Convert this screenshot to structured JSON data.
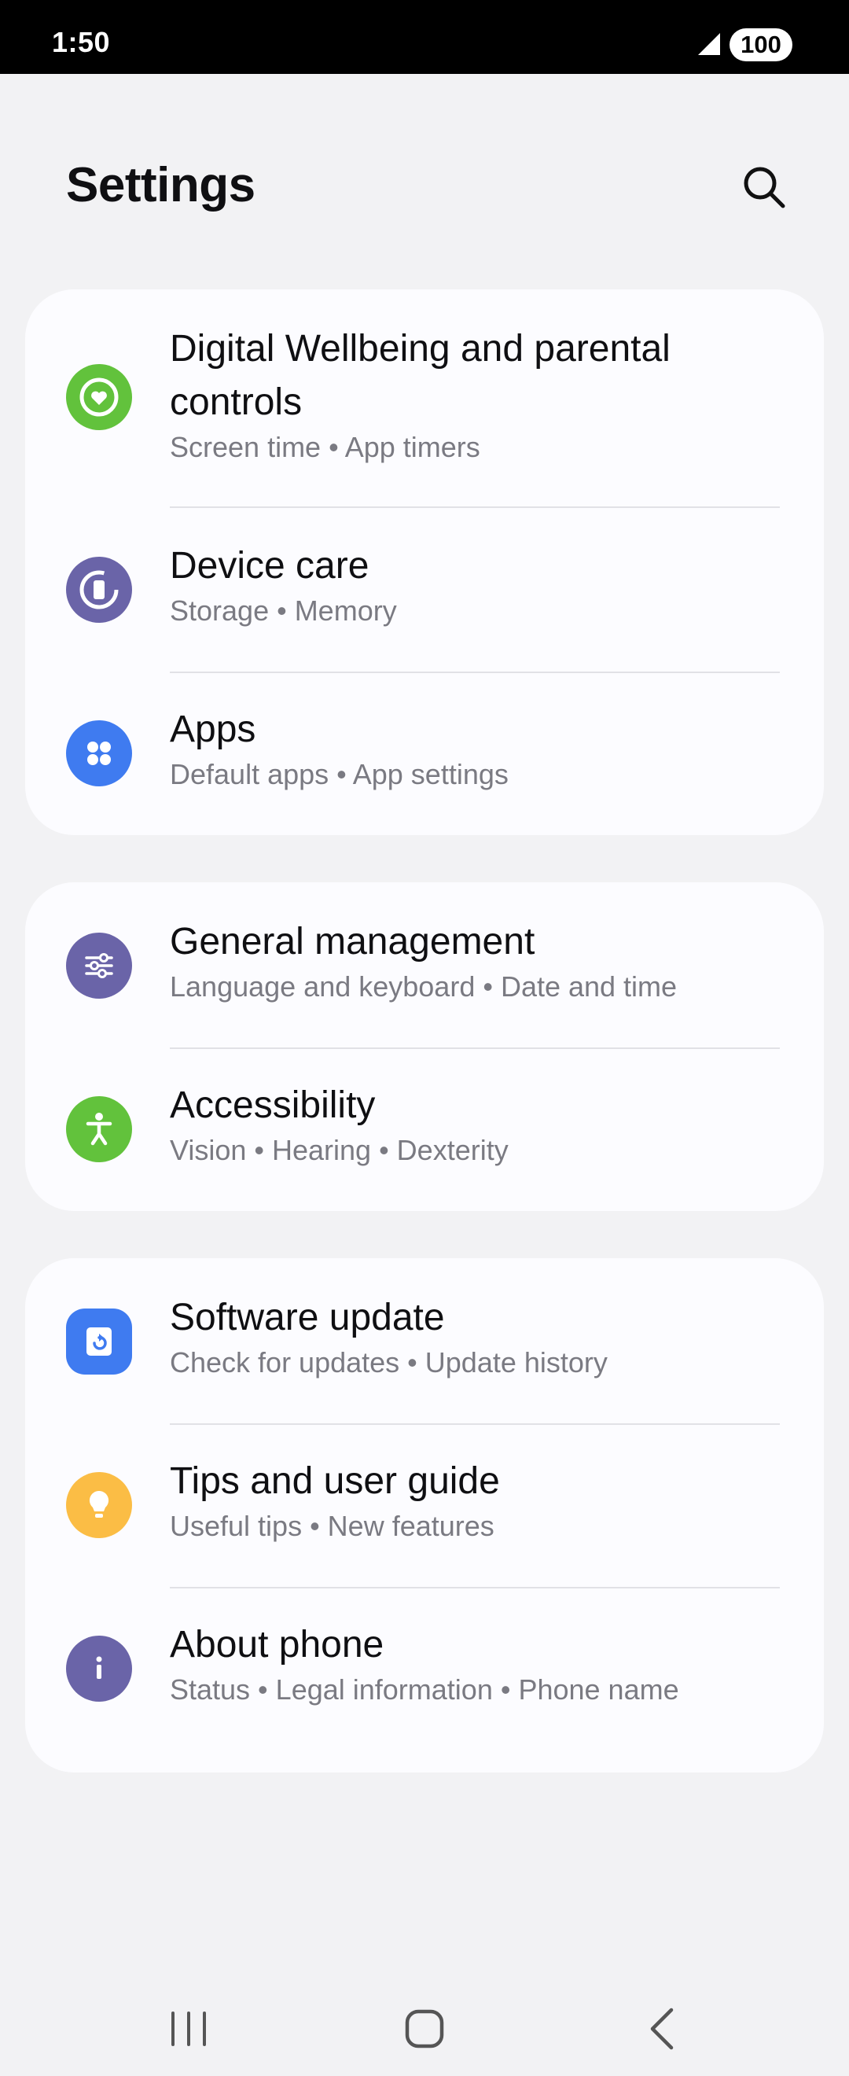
{
  "status_bar": {
    "time": "1:50",
    "battery": "100",
    "signal_icon": "cell-signal-icon"
  },
  "header": {
    "title": "Settings",
    "search_icon": "search-icon"
  },
  "cards": [
    {
      "items": [
        {
          "title": "Digital Wellbeing and parental controls",
          "subtitle": "Screen time  •  App timers",
          "icon": "digital-wellbeing-icon",
          "icon_color": "#62c23c"
        },
        {
          "title": "Device care",
          "subtitle": "Storage  •  Memory",
          "icon": "device-care-icon",
          "icon_color": "#6a64a8"
        },
        {
          "title": "Apps",
          "subtitle": "Default apps  •  App settings",
          "icon": "apps-icon",
          "icon_color": "#3f7bf0"
        }
      ]
    },
    {
      "items": [
        {
          "title": "General management",
          "subtitle": "Language and keyboard  •  Date and time",
          "icon": "general-management-icon",
          "icon_color": "#6a64a8"
        },
        {
          "title": "Accessibility",
          "subtitle": "Vision  •  Hearing  •  Dexterity",
          "icon": "accessibility-icon",
          "icon_color": "#62c23c"
        }
      ]
    },
    {
      "items": [
        {
          "title": "Software update",
          "subtitle": "Check for updates  •  Update history",
          "icon": "software-update-icon",
          "icon_color": "#3f7bf0"
        },
        {
          "title": "Tips and user guide",
          "subtitle": "Useful tips  •  New features",
          "icon": "tips-lightbulb-icon",
          "icon_color": "#fbbd45"
        },
        {
          "title": "About phone",
          "subtitle": "Status  •  Legal information  •  Phone name",
          "icon": "about-phone-info-icon",
          "icon_color": "#6a64a8"
        }
      ]
    }
  ],
  "nav_bar": {
    "recents_icon": "recents-icon",
    "home_icon": "home-icon",
    "back_icon": "back-icon"
  }
}
